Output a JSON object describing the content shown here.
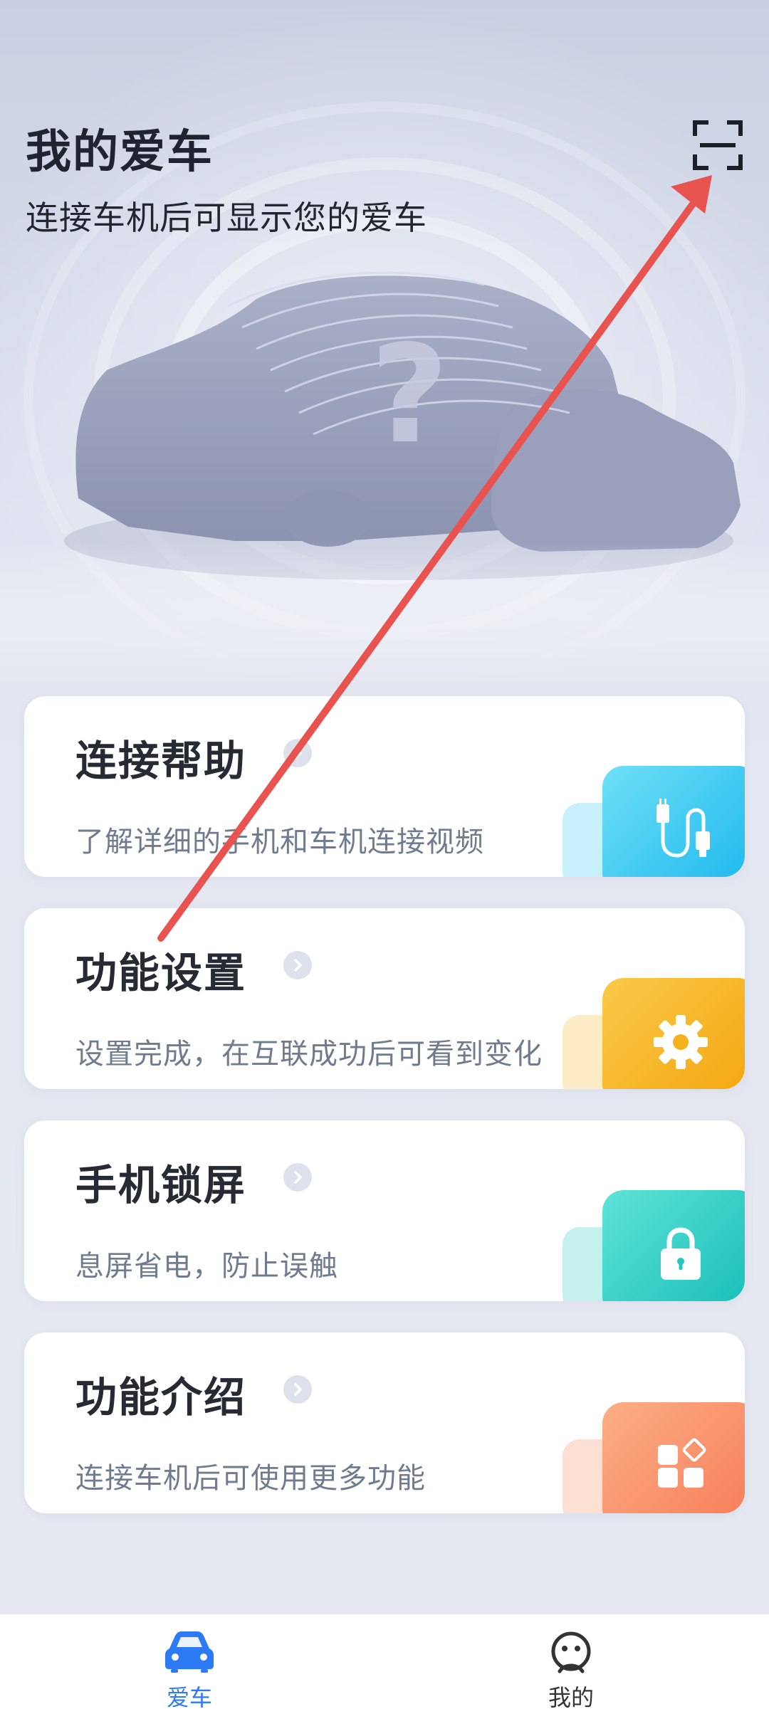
{
  "header": {
    "title": "我的爱车",
    "subtitle": "连接车机后可显示您的爱车",
    "scan_icon": "scan-icon"
  },
  "cards": [
    {
      "title": "连接帮助",
      "desc": "了解详细的手机和车机连接视频",
      "icon": "usb-cable-icon",
      "color": "#2fc3f1"
    },
    {
      "title": "功能设置",
      "desc": "设置完成，在互联成功后可看到变化",
      "icon": "gear-icon",
      "color": "#f6b21c"
    },
    {
      "title": "手机锁屏",
      "desc": "息屏省电，防止误触",
      "icon": "lock-icon",
      "color": "#22c7c0"
    },
    {
      "title": "功能介绍",
      "desc": "连接车机后可使用更多功能",
      "icon": "apps-grid-icon",
      "color": "#f98c67"
    }
  ],
  "tabbar": {
    "items": [
      {
        "label": "爱车",
        "icon": "car-icon",
        "active": true
      },
      {
        "label": "我的",
        "icon": "profile-face-icon",
        "active": false
      }
    ],
    "active_color": "#2d7bf4",
    "inactive_color": "#333333"
  }
}
